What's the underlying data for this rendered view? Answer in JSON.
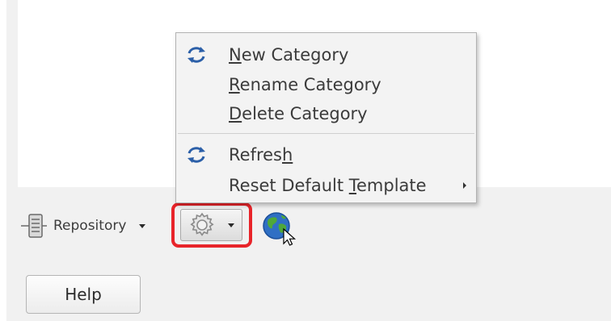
{
  "toolbar": {
    "repository": {
      "label": "Repository",
      "icon": "repository-icon"
    },
    "gear": {
      "icon": "gear-icon"
    },
    "globe": {
      "icon": "globe-icon"
    }
  },
  "menu": {
    "items": [
      {
        "pre": "",
        "accel": "N",
        "post": "ew Category",
        "icon": "refresh-icon"
      },
      {
        "pre": "",
        "accel": "R",
        "post": "ename Category",
        "icon": ""
      },
      {
        "pre": "",
        "accel": "D",
        "post": "elete Category",
        "icon": ""
      },
      {
        "pre": "Refres",
        "accel": "h",
        "post": "",
        "icon": "refresh-icon"
      },
      {
        "pre": "Reset Default ",
        "accel": "T",
        "post": "emplate",
        "icon": "",
        "submenu": true
      }
    ]
  },
  "help": {
    "label": "Help"
  },
  "colors": {
    "highlight_border": "#e8242a"
  }
}
